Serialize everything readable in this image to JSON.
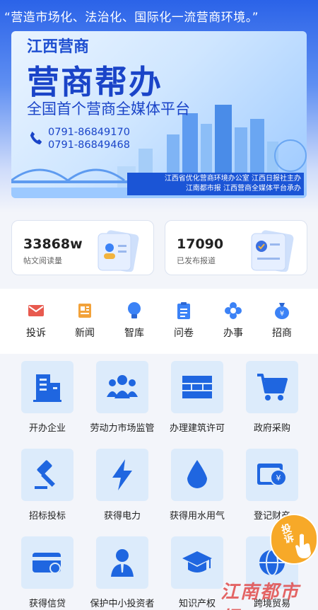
{
  "header": {
    "slogan": "“营造市场化、法治化、国际化一流营商环境。”"
  },
  "banner": {
    "brand": "江西营商",
    "headline": "营商帮办",
    "subtitle": "全国首个营商全媒体平台",
    "phones": [
      "0791-86849170",
      "0791-86849468"
    ],
    "footer_line1": "江西省优化营商环境办公室  江西日报社主办",
    "footer_line2": "江南都市报  江西营商全媒体平台承办"
  },
  "stats": [
    {
      "value": "33868w",
      "label": "帖文阅读量"
    },
    {
      "value": "17090",
      "label": "已发布报道"
    }
  ],
  "quick_nav": [
    {
      "label": "投诉",
      "icon": "envelope-icon",
      "color": "#e85a4f"
    },
    {
      "label": "新闻",
      "icon": "news-icon",
      "color": "#f2a23a"
    },
    {
      "label": "智库",
      "icon": "lightbulb-icon",
      "color": "#3b82f6"
    },
    {
      "label": "问卷",
      "icon": "clipboard-icon",
      "color": "#3b82f6"
    },
    {
      "label": "办事",
      "icon": "flower-gear-icon",
      "color": "#3b82f6"
    },
    {
      "label": "招商",
      "icon": "money-bag-icon",
      "color": "#3b82f6"
    }
  ],
  "services": [
    {
      "label": "开办企业",
      "icon": "building-icon"
    },
    {
      "label": "劳动力市场监管",
      "icon": "people-group-icon"
    },
    {
      "label": "办理建筑许可",
      "icon": "brick-wall-icon"
    },
    {
      "label": "政府采购",
      "icon": "shopping-cart-icon"
    },
    {
      "label": "招标投标",
      "icon": "gavel-icon"
    },
    {
      "label": "获得电力",
      "icon": "lightning-icon"
    },
    {
      "label": "获得用水用气",
      "icon": "water-drop-icon"
    },
    {
      "label": "登记财产",
      "icon": "property-icon"
    },
    {
      "label": "获得信贷",
      "icon": "credit-card-icon"
    },
    {
      "label": "保护中小投资者",
      "icon": "investor-icon"
    },
    {
      "label": "知识产权",
      "icon": "graduation-cap-icon"
    },
    {
      "label": "跨境贸易",
      "icon": "globe-icon"
    }
  ],
  "float_button": {
    "label": "投诉"
  },
  "watermark": "江南都市报",
  "colors": {
    "primary": "#2b63e8",
    "icon_blue": "#1f66e0",
    "tile_bg": "#dcebfb",
    "accent_orange": "#f7a928"
  }
}
